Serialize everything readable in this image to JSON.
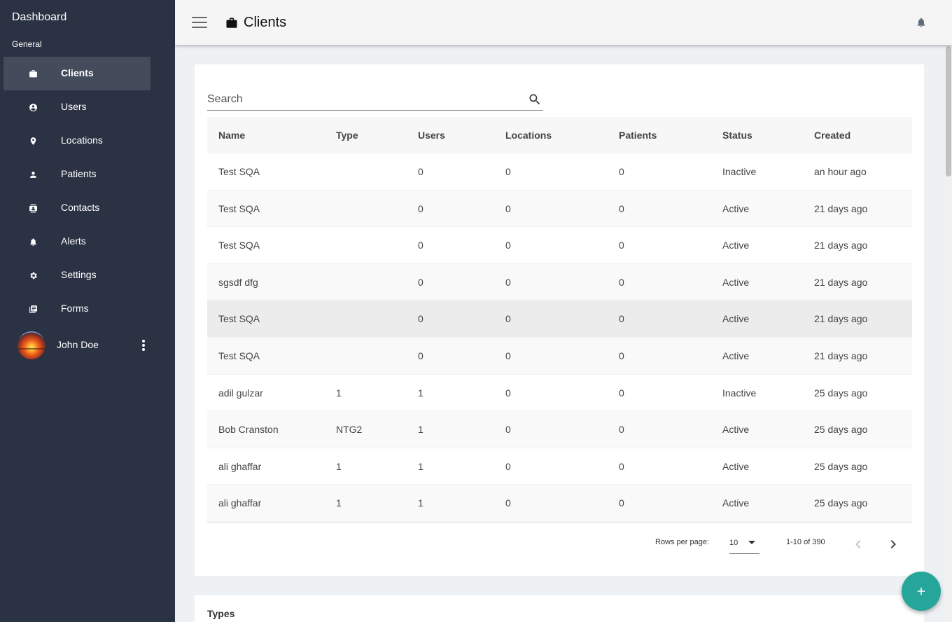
{
  "sidebar": {
    "title": "Dashboard",
    "section": "General",
    "items": [
      {
        "label": "Clients",
        "icon": "briefcase-icon"
      },
      {
        "label": "Users",
        "icon": "account-circle-icon"
      },
      {
        "label": "Locations",
        "icon": "map-pin-icon"
      },
      {
        "label": "Patients",
        "icon": "person-icon"
      },
      {
        "label": "Contacts",
        "icon": "contact-card-icon"
      },
      {
        "label": "Alerts",
        "icon": "bell-icon"
      },
      {
        "label": "Settings",
        "icon": "gear-icon"
      },
      {
        "label": "Forms",
        "icon": "forms-icon"
      }
    ],
    "active_item": "Clients",
    "user": {
      "name": "John Doe"
    }
  },
  "header": {
    "title": "Clients",
    "title_icon": "briefcase-icon",
    "notification_icon": "bell-icon"
  },
  "search": {
    "placeholder": "Search"
  },
  "table": {
    "columns": [
      "Name",
      "Type",
      "Users",
      "Locations",
      "Patients",
      "Status",
      "Created"
    ],
    "rows": [
      [
        "Test SQA",
        "",
        "0",
        "0",
        "0",
        "Inactive",
        "an hour ago"
      ],
      [
        "Test SQA",
        "",
        "0",
        "0",
        "0",
        "Active",
        "21 days ago"
      ],
      [
        "Test SQA",
        "",
        "0",
        "0",
        "0",
        "Active",
        "21 days ago"
      ],
      [
        "sgsdf dfg",
        "",
        "0",
        "0",
        "0",
        "Active",
        "21 days ago"
      ],
      [
        "Test SQA",
        "",
        "0",
        "0",
        "0",
        "Active",
        "21 days ago"
      ],
      [
        "Test SQA",
        "",
        "0",
        "0",
        "0",
        "Active",
        "21 days ago"
      ],
      [
        "adil gulzar",
        "1",
        "1",
        "0",
        "0",
        "Inactive",
        "25 days ago"
      ],
      [
        "Bob Cranston",
        "NTG2",
        "1",
        "0",
        "0",
        "Active",
        "25 days ago"
      ],
      [
        "ali ghaffar",
        "1",
        "1",
        "0",
        "0",
        "Active",
        "25 days ago"
      ],
      [
        "ali ghaffar",
        "1",
        "1",
        "0",
        "0",
        "Active",
        "25 days ago"
      ]
    ]
  },
  "pagination": {
    "rows_per_page_label": "Rows per page:",
    "rows_per_page_value": "10",
    "range_label": "1-10 of 390"
  },
  "types_card": {
    "title": "Types"
  },
  "colors": {
    "sidebar_bg": "#2b3244",
    "sidebar_active_bg": "#444b5b",
    "fab": "#26a69a"
  }
}
